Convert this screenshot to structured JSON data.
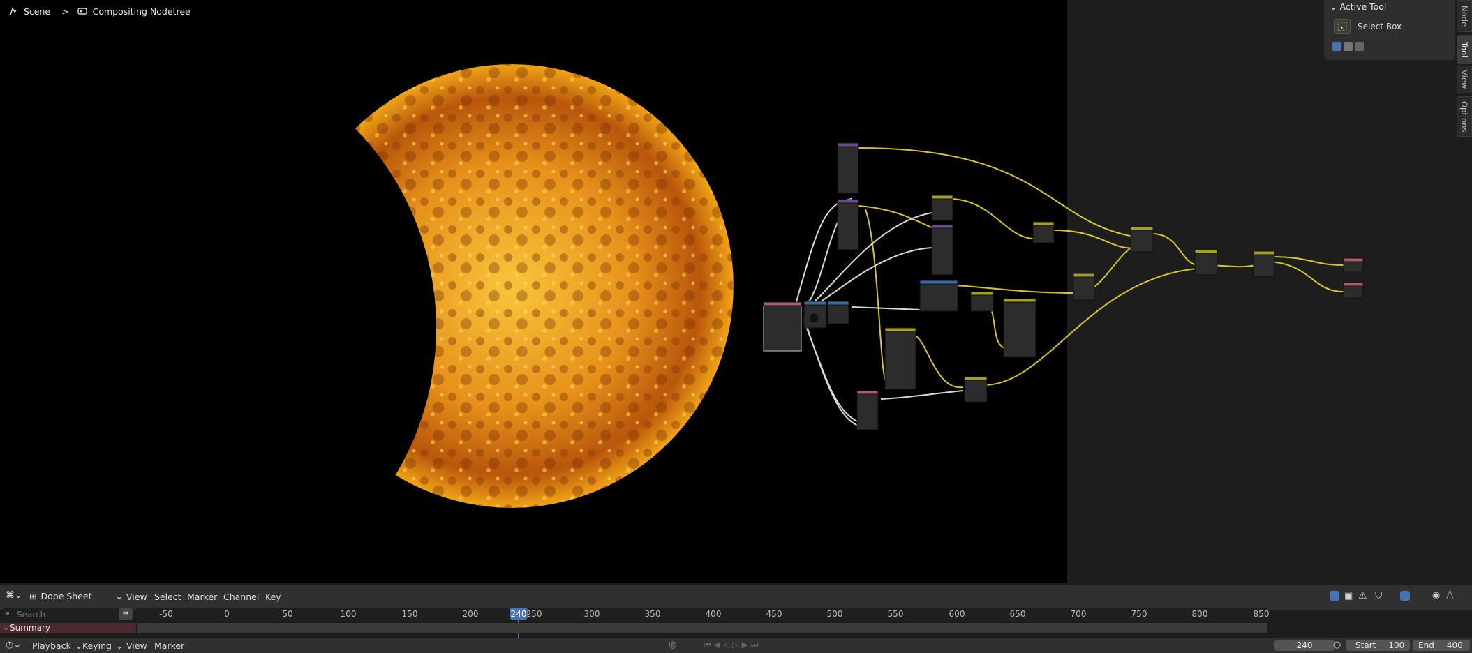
{
  "breadcrumb": {
    "scene": "Scene",
    "separator": ">",
    "tree": "Compositing Nodetree"
  },
  "side_tabs": [
    "Node",
    "Tool",
    "View",
    "Options"
  ],
  "active_tool": {
    "header": "Active Tool",
    "tool_name": "Select Box"
  },
  "timeline": {
    "editor_type": "Dope Sheet",
    "menus": [
      "View",
      "Select",
      "Marker",
      "Channel",
      "Key"
    ],
    "search_placeholder": "Search",
    "ruler_ticks": [
      "-50",
      "0",
      "50",
      "100",
      "150",
      "200",
      "250",
      "300",
      "350",
      "400",
      "450",
      "500",
      "550",
      "600",
      "650",
      "700",
      "750",
      "800",
      "850"
    ],
    "current_frame": "240",
    "summary_label": "Summary",
    "bottom_menus": [
      "Playback",
      "Keying",
      "View",
      "Marker"
    ],
    "frame_field": "240",
    "start_label": "Start",
    "start_value": "100",
    "end_label": "End",
    "end_value": "400"
  },
  "icons": {
    "scene": "scene-icon",
    "nodetree": "node-tree-icon",
    "select_box": "select-box-icon",
    "search": "search-icon"
  },
  "colors": {
    "backdrop": "#000000",
    "sun_core": "#f6b21b",
    "link": "#d9c636",
    "accent": "#4772b3"
  }
}
